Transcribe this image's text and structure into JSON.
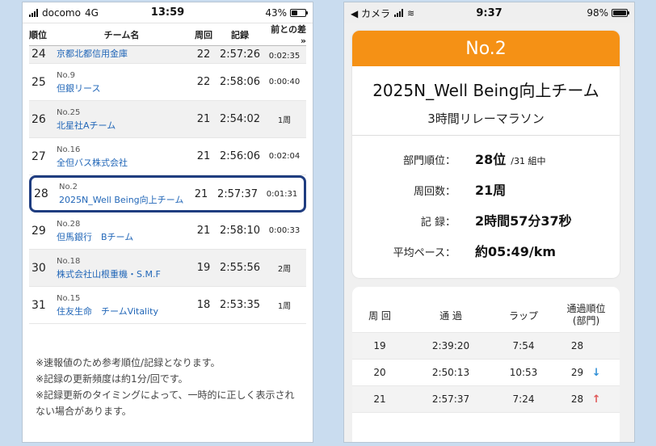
{
  "left": {
    "status": {
      "carrier": "docomo",
      "network": "4G",
      "time": "13:59",
      "battery_pct": "43%",
      "battery_level": 0.43
    },
    "headers": {
      "rank": "順位",
      "team": "チーム名",
      "laps": "周回",
      "time": "記録",
      "diff": "前との差 »"
    },
    "rows": [
      {
        "rank": "24",
        "no": "",
        "name": "京都北都信用金庫",
        "laps": "22",
        "time": "2:57:26",
        "diff": "0:02:35"
      },
      {
        "rank": "25",
        "no": "No.9",
        "name": "但銀リース",
        "laps": "22",
        "time": "2:58:06",
        "diff": "0:00:40"
      },
      {
        "rank": "26",
        "no": "No.25",
        "name": "北星社Aチーム",
        "laps": "21",
        "time": "2:54:02",
        "diff": "1周"
      },
      {
        "rank": "27",
        "no": "No.16",
        "name": "全但バス株式会社",
        "laps": "21",
        "time": "2:56:06",
        "diff": "0:02:04"
      },
      {
        "rank": "28",
        "no": "No.2",
        "name": "2025N_Well Being向上チーム",
        "laps": "21",
        "time": "2:57:37",
        "diff": "0:01:31"
      },
      {
        "rank": "29",
        "no": "No.28",
        "name": "但馬銀行　Bチーム",
        "laps": "21",
        "time": "2:58:10",
        "diff": "0:00:33"
      },
      {
        "rank": "30",
        "no": "No.18",
        "name": "株式会社山根重機・S.M.F",
        "laps": "19",
        "time": "2:55:56",
        "diff": "2周"
      },
      {
        "rank": "31",
        "no": "No.15",
        "name": "住友生命　チームVitality",
        "laps": "18",
        "time": "2:53:35",
        "diff": "1周"
      }
    ],
    "notes": [
      "※速報値のため参考順位/記録となります。",
      "※記録の更新頻度は約1分/回です。",
      "※記録更新のタイミングによって、一時的に正しく表示されない場合があります。"
    ]
  },
  "right": {
    "status": {
      "back_app": "◀ カメラ",
      "time": "9:37",
      "battery_pct": "98%",
      "battery_level": 0.98
    },
    "banner": "No.2",
    "team_name": "2025N_Well Being向上チーム",
    "event": "3時間リレーマラソン",
    "stats": {
      "rank_label": "部門順位：",
      "rank_value": "28位",
      "rank_sub": "/31 組中",
      "laps_label": "周回数：",
      "laps_value": "21周",
      "record_label": "記 録：",
      "record_value": "2時間57分37秒",
      "pace_label": "平均ペース：",
      "pace_value": "約05:49/km"
    },
    "lap_headers": {
      "lap": "周 回",
      "split": "通 過",
      "lap_time": "ラップ",
      "pos_line1": "通過順位",
      "pos_line2": "(部門)"
    },
    "laps": [
      {
        "lap": "19",
        "split": "2:39:20",
        "lap_time": "7:54",
        "pos": "28",
        "arrow": ""
      },
      {
        "lap": "20",
        "split": "2:50:13",
        "lap_time": "10:53",
        "pos": "29",
        "arrow": "↓"
      },
      {
        "lap": "21",
        "split": "2:57:37",
        "lap_time": "7:24",
        "pos": "28",
        "arrow": "↑"
      }
    ]
  },
  "colors": {
    "banner": "#f59115",
    "highlight_border": "#1f3d80",
    "link": "#2267b8",
    "arrow_down": "#2f8fd6",
    "arrow_up": "#e05757"
  }
}
